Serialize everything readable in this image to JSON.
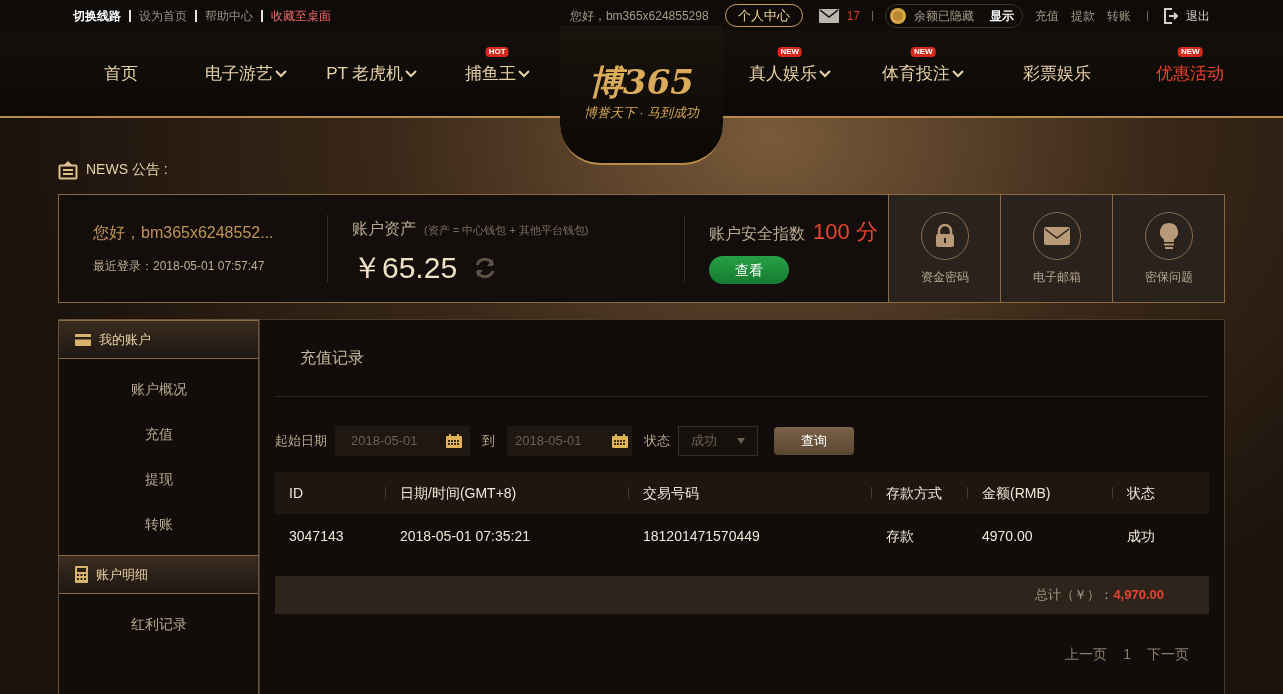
{
  "top_bar": {
    "links": [
      {
        "label": "切换线路",
        "kind": "strong"
      },
      {
        "label": "设为首页",
        "kind": "plain"
      },
      {
        "label": "帮助中心",
        "kind": "plain"
      },
      {
        "label": "收藏至桌面",
        "kind": "alert"
      }
    ],
    "greeting": "您好，bm365x624855298",
    "center_button": "个人中心",
    "mail_count": "17",
    "balance_hidden": "余额已隐藏",
    "show_button": "显示",
    "actions": [
      "充值",
      "提款",
      "转账"
    ],
    "logout": "退出"
  },
  "nav": {
    "left": [
      {
        "label": "首页",
        "dropdown": false,
        "highlight": false
      },
      {
        "label": "电子游艺",
        "dropdown": true,
        "highlight": false
      },
      {
        "label": "PT 老虎机",
        "dropdown": true,
        "highlight": false
      },
      {
        "label": "捕鱼王",
        "badge": "HOT",
        "dropdown": true,
        "highlight": false
      }
    ],
    "logo": {
      "name": "博365",
      "slogan": "博誉天下 · 马到成功"
    },
    "right": [
      {
        "label": "真人娱乐",
        "badge": "NEW",
        "dropdown": true,
        "highlight": false
      },
      {
        "label": "体育投注",
        "badge": "NEW",
        "dropdown": true,
        "highlight": false
      },
      {
        "label": "彩票娱乐",
        "dropdown": false,
        "highlight": false
      },
      {
        "label": "优惠活动",
        "badge": "NEW",
        "dropdown": false,
        "highlight": true
      }
    ]
  },
  "news": {
    "label": "NEWS 公告 :"
  },
  "account": {
    "greeting": "您好，bm365x6248552...",
    "last_login": "最近登录：2018-05-01 07:57:47",
    "assets_title": "账户资产",
    "assets_note": "(资产 = 中心钱包 + 其他平台钱包)",
    "balance": "￥65.25",
    "security_title": "账户安全指数",
    "security_score": "100",
    "security_unit": "分",
    "view_button": "查看",
    "tiles": [
      {
        "label": "资金密码",
        "kind": "lock"
      },
      {
        "label": "电子邮箱",
        "kind": "mail"
      },
      {
        "label": "密保问题",
        "kind": "bulb"
      }
    ]
  },
  "sidebar": [
    {
      "title": "我的账户",
      "kind": "card",
      "items": [
        "账户概况",
        "充值",
        "提现",
        "转账"
      ]
    },
    {
      "title": "账户明细",
      "kind": "calc",
      "items": [
        "红利记录"
      ]
    }
  ],
  "main": {
    "title": "充值记录",
    "filter": {
      "start_label": "起始日期",
      "start_value": "2018-05-01",
      "to_label": "到",
      "end_value": "2018-05-01",
      "status_label": "状态",
      "status_value": "成功",
      "query_button": "查询"
    },
    "table": {
      "columns": [
        "ID",
        "日期/时间(GMT+8)",
        "交易号码",
        "存款方式",
        "金额(RMB)",
        "状态"
      ],
      "rows": [
        [
          "3047143",
          "2018-05-01 07:35:21",
          "181201471570449",
          "存款",
          "4970.00",
          "成功"
        ]
      ]
    },
    "total_label": "总计（￥）：",
    "total_value": "4,970.00",
    "pager": {
      "prev": "上一页",
      "page": "1",
      "next": "下一页"
    }
  }
}
